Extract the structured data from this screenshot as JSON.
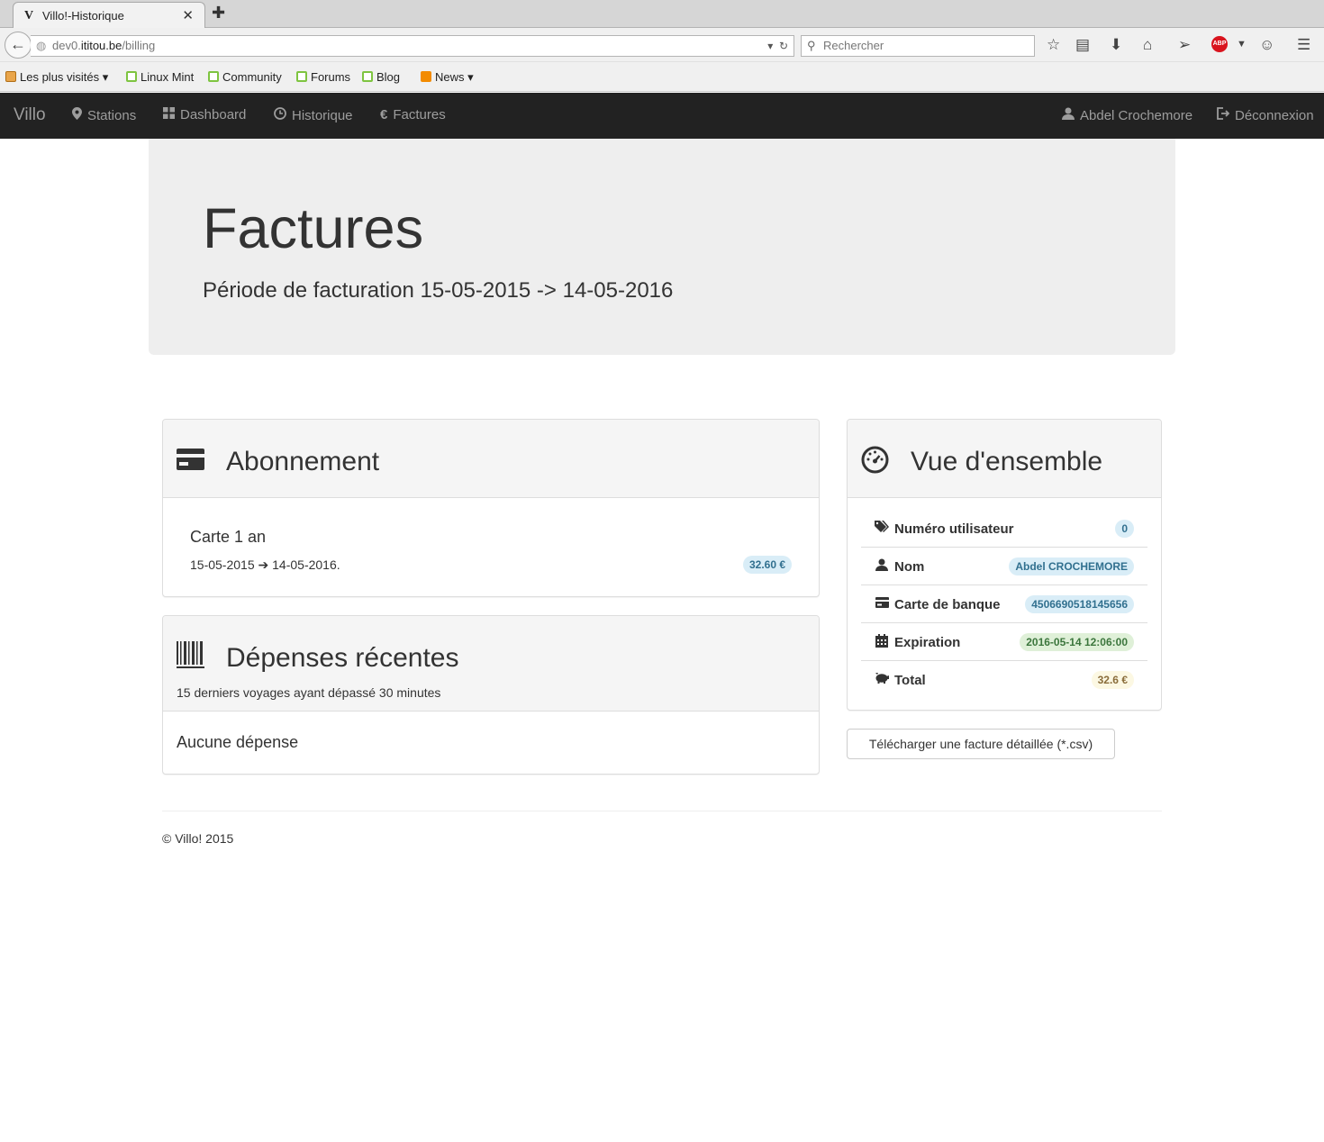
{
  "browser": {
    "tab_favicon": "V",
    "tab_title": "Villo!-Historique",
    "url_host_prefix": "dev0.",
    "url_host_domain": "ititou.be",
    "url_path": "/billing",
    "search_placeholder": "Rechercher",
    "bookmarks": [
      {
        "label": "Les plus visités",
        "icon": "folder-icon",
        "dropdown": true
      },
      {
        "label": "Linux Mint",
        "icon": "mint-icon"
      },
      {
        "label": "Community",
        "icon": "mint-icon"
      },
      {
        "label": "Forums",
        "icon": "mint-icon"
      },
      {
        "label": "Blog",
        "icon": "mint-icon"
      },
      {
        "label": "News",
        "icon": "rss-icon",
        "dropdown": true
      }
    ],
    "abp_label": "ABP"
  },
  "nav": {
    "brand": "Villo",
    "items": [
      {
        "label": "Stations",
        "icon": "map-marker-icon"
      },
      {
        "label": "Dashboard",
        "icon": "dashboard-icon"
      },
      {
        "label": "Historique",
        "icon": "clock-icon"
      },
      {
        "label": "Factures",
        "icon": "euro-icon"
      }
    ],
    "user": "Abdel Crochemore",
    "logout": "Déconnexion"
  },
  "jumbotron": {
    "title": "Factures",
    "subtitle": "Période de facturation 15-05-2015 -> 14-05-2016"
  },
  "subscription": {
    "heading": "Abonnement",
    "name": "Carte 1 an",
    "start": "15-05-2015",
    "end": "14-05-2016.",
    "price": "32.60 €"
  },
  "expenses": {
    "heading": "Dépenses récentes",
    "subheading": "15 derniers voyages ayant dépassé 30 minutes",
    "empty": "Aucune dépense"
  },
  "overview": {
    "heading": "Vue d'ensemble",
    "rows": [
      {
        "label": "Numéro utilisateur",
        "value": "0",
        "icon": "tags-icon",
        "style": "info"
      },
      {
        "label": "Nom",
        "value": "Abdel CROCHEMORE",
        "icon": "user-icon",
        "style": "info"
      },
      {
        "label": "Carte de banque",
        "value": "4506690518145656",
        "icon": "credit-card-icon",
        "style": "info"
      },
      {
        "label": "Expiration",
        "value": "2016-05-14 12:06:00",
        "icon": "calendar-icon",
        "style": "success"
      },
      {
        "label": "Total",
        "value": "32.6 €",
        "icon": "piggy-bank-icon",
        "style": "warning"
      }
    ],
    "download_button": "Télécharger une facture détaillée (*.csv)"
  },
  "footer": {
    "text": "© Villo! 2015"
  }
}
